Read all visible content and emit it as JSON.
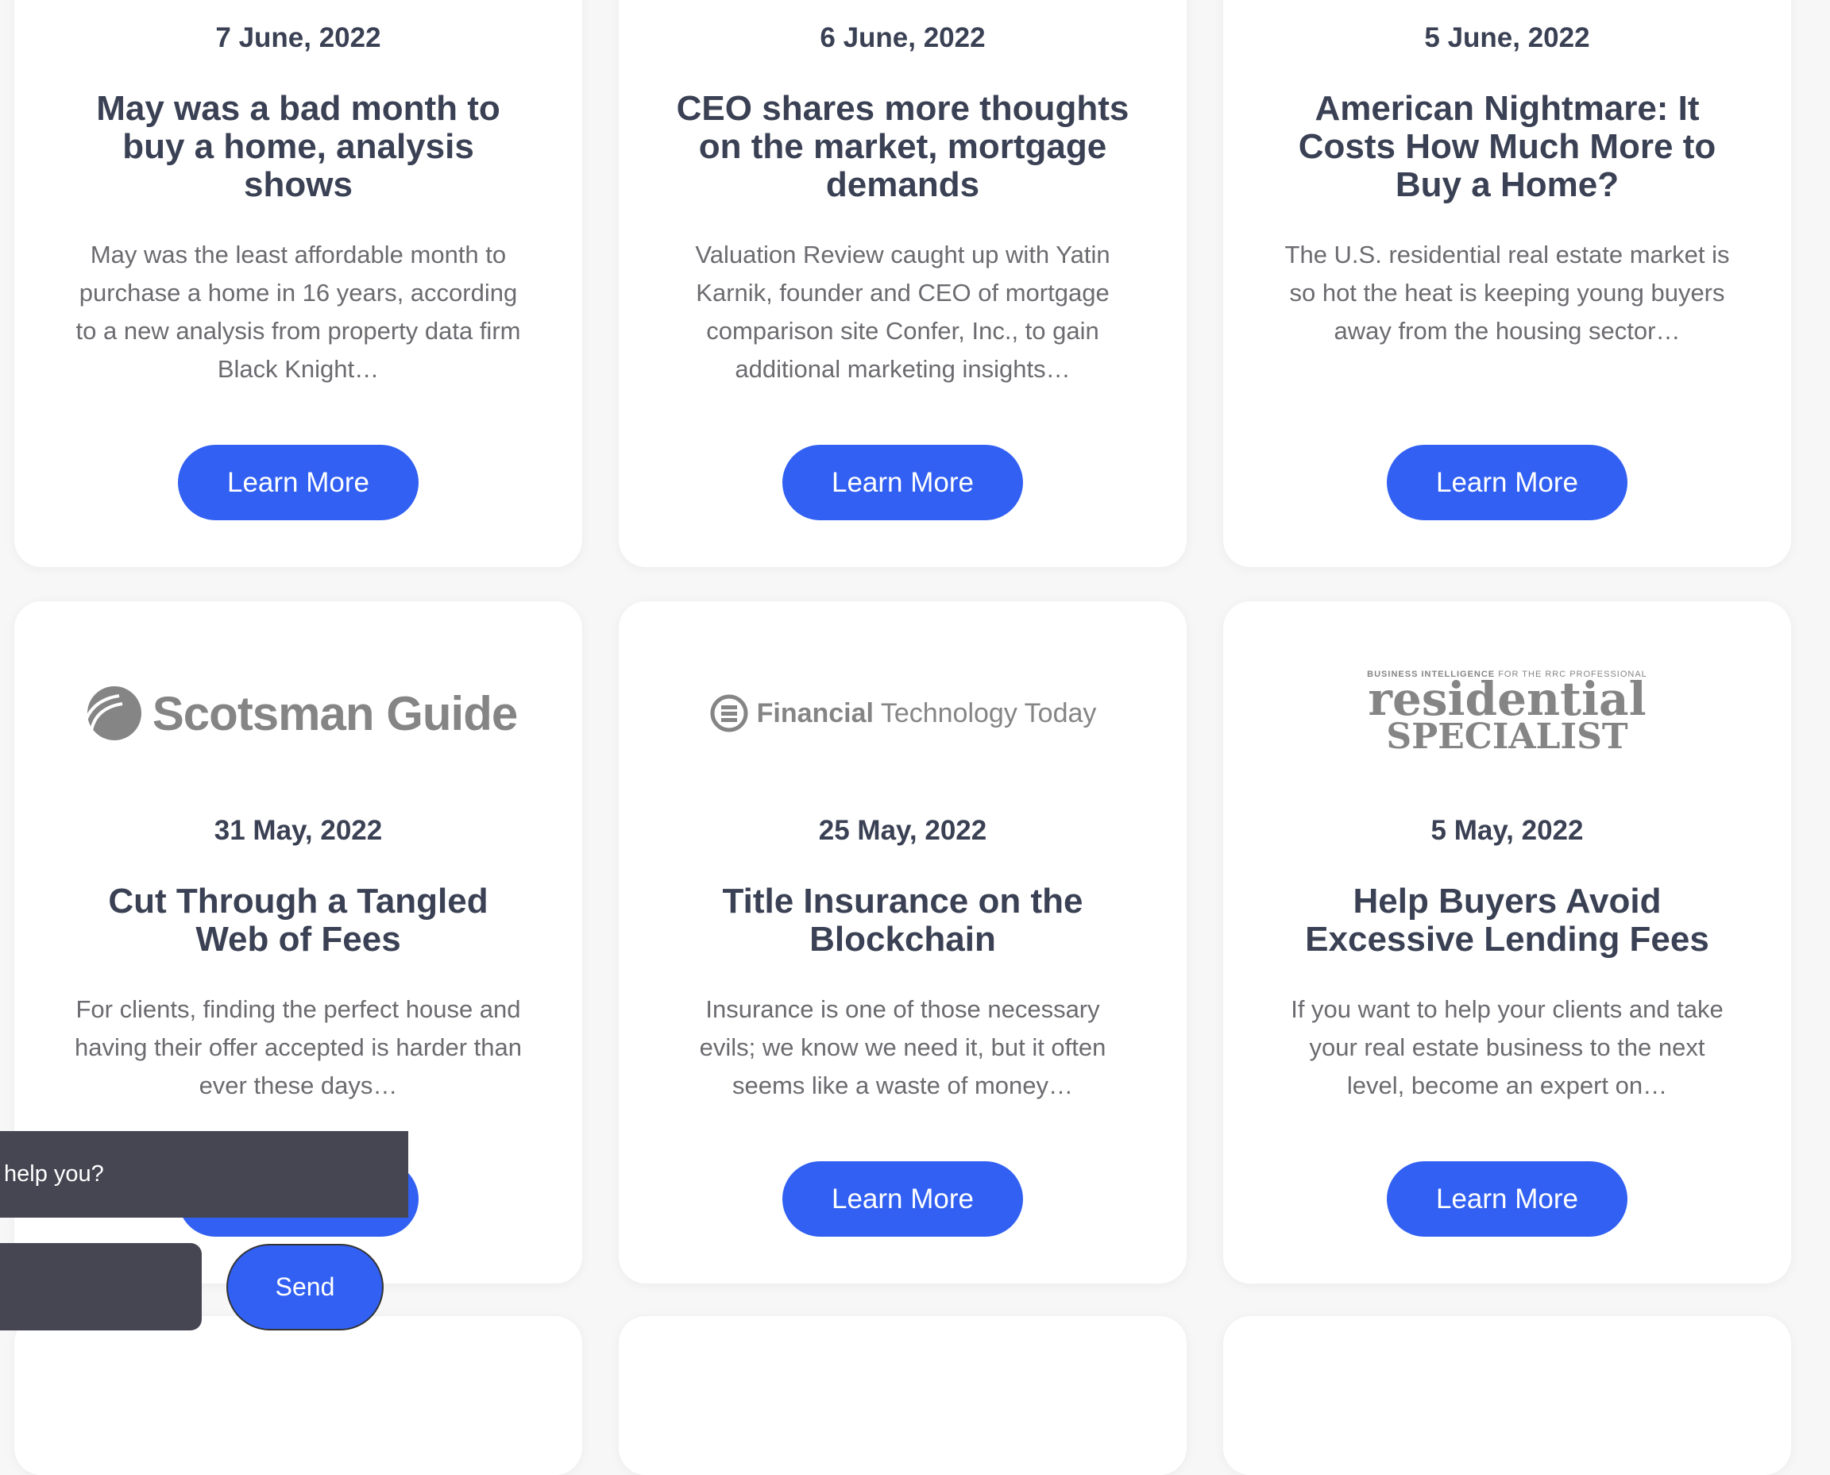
{
  "articles": [
    {
      "date": "7 June, 2022",
      "title": "May was a bad month to buy a home, analysis shows",
      "excerpt": "May was the least affordable month to purchase a home in 16 years, according to a new analysis from property data firm Black Knight…",
      "button": "Learn More"
    },
    {
      "date": "6 June, 2022",
      "title": "CEO shares more thoughts on the market, mortgage demands",
      "excerpt": "Valuation Review caught up with Yatin Karnik, founder and CEO of mortgage comparison site Confer, Inc., to gain additional marketing insights…",
      "button": "Learn More"
    },
    {
      "date": "5 June, 2022",
      "title": "American Nightmare: It Costs How Much More to Buy a Home?",
      "excerpt": "The U.S. residential real estate market is so hot the heat is keeping young buyers away from the housing sector…",
      "button": "Learn More"
    },
    {
      "logo": "Scotsman Guide",
      "date": "31 May, 2022",
      "title": "Cut Through a Tangled Web of Fees",
      "excerpt": "For clients, finding the perfect house and having their offer accepted is harder than ever these days…",
      "button": "Learn More"
    },
    {
      "logo": "Financial Technology Today",
      "date": "25 May, 2022",
      "title": "Title Insurance on the Blockchain",
      "excerpt": "Insurance is one of those necessary evils; we know we need it, but it often seems like a waste of money…",
      "button": "Learn More"
    },
    {
      "logo": "Business Intelligence for the RRC Professional — The Residential Specialist",
      "date": "5 May, 2022",
      "title": "Help Buyers Avoid Excessive Lending Fees",
      "excerpt": "If you want to help your clients and take your real estate business to the next level, become an expert on…",
      "button": "Learn More"
    }
  ],
  "chat": {
    "message": "help you?",
    "input_value": "",
    "send": "Send"
  },
  "colors": {
    "accent": "#3160f2",
    "text": "#3b4154",
    "chat_bg": "#454652"
  }
}
